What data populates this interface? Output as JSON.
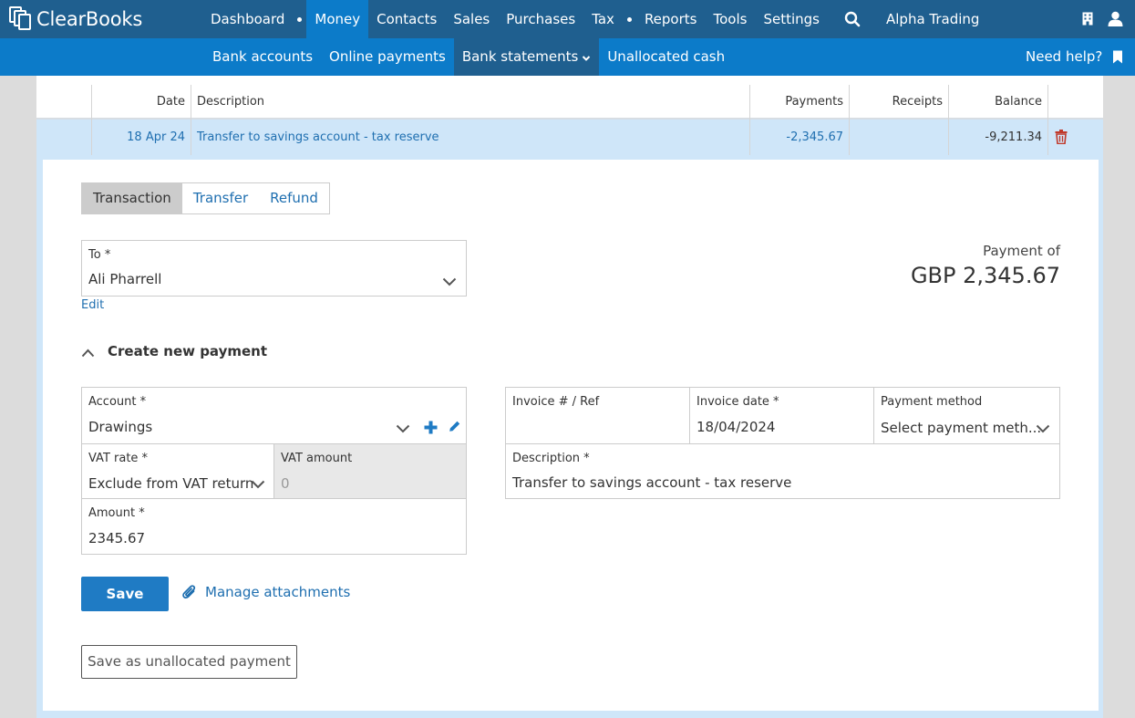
{
  "app": {
    "name": "ClearBooks"
  },
  "main_nav": {
    "items": [
      "Dashboard",
      "Money",
      "Contacts",
      "Sales",
      "Purchases",
      "Tax",
      "Reports",
      "Tools",
      "Settings"
    ],
    "active": "Money",
    "company": "Alpha Trading"
  },
  "sub_nav": {
    "items": [
      "Bank accounts",
      "Online payments",
      "Bank statements",
      "Unallocated cash"
    ],
    "active": "Bank statements",
    "help": "Need help?"
  },
  "table": {
    "headers": {
      "date": "Date",
      "description": "Description",
      "payments": "Payments",
      "receipts": "Receipts",
      "balance": "Balance"
    },
    "row": {
      "date": "18 Apr 24",
      "description": "Transfer to savings account - tax reserve",
      "payments": "-2,345.67",
      "receipts": "",
      "balance": "-9,211.34"
    }
  },
  "tabs": [
    "Transaction",
    "Transfer",
    "Refund"
  ],
  "to_field": {
    "label": "To *",
    "value": "Ali Pharrell",
    "edit_link": "Edit"
  },
  "payment": {
    "label": "Payment of",
    "amount": "GBP 2,345.67"
  },
  "section": {
    "title": "Create new payment"
  },
  "form": {
    "account": {
      "label": "Account *",
      "value": "Drawings"
    },
    "vat_rate": {
      "label": "VAT rate *",
      "value": "Exclude from VAT return"
    },
    "vat_amount": {
      "label": "VAT amount",
      "placeholder": "0"
    },
    "amount": {
      "label": "Amount *",
      "value": "2345.67"
    },
    "invoice_ref": {
      "label": "Invoice # / Ref",
      "value": ""
    },
    "invoice_date": {
      "label": "Invoice date *",
      "value": "18/04/2024"
    },
    "payment_method": {
      "label": "Payment method",
      "value": "Select payment meth..."
    },
    "description": {
      "label": "Description *",
      "value": "Transfer to savings account - tax reserve"
    }
  },
  "buttons": {
    "save": "Save",
    "manage_attachments": "Manage attachments",
    "save_unallocated": "Save as unallocated payment"
  },
  "colors": {
    "topbar": "#1f5f8f",
    "subbar": "#0c7bc9",
    "accent": "#1f6fb0",
    "row_highlight": "#cfe6f9",
    "delete": "#c0392b"
  }
}
